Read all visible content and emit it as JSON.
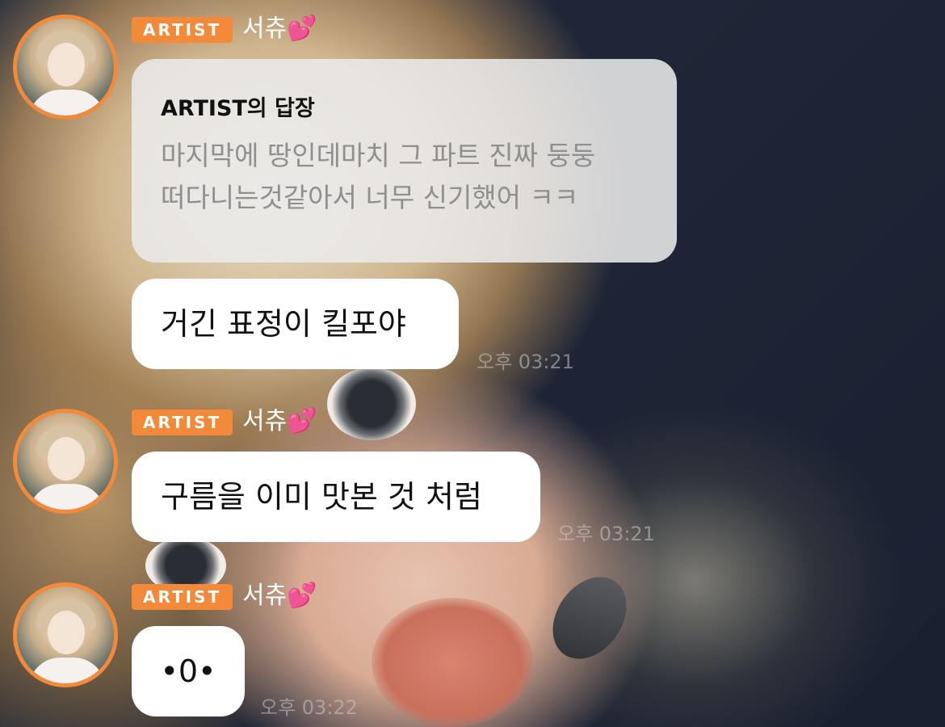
{
  "messages": [
    {
      "badge": "ARTIST",
      "name": "서츄💕",
      "reply": {
        "title": "ARTIST의 답장",
        "line1": "마지막에 땅인데마치 그 파트 진짜 둥둥",
        "line2": "떠다니는것같아서 너무 신기했어 ㅋㅋ"
      },
      "text": "거긴 표정이 킬포야",
      "time": "오후 03:21"
    },
    {
      "badge": "ARTIST",
      "name": "서츄💕",
      "text": "구름을 이미 맛본 것 처럼",
      "time": "오후 03:21"
    },
    {
      "badge": "ARTIST",
      "name": "서츄💕",
      "text": "•0•",
      "time": "오후 03:22"
    }
  ],
  "colors": {
    "accent": "#f28a3a",
    "bubble": "#ffffff",
    "reply_bubble": "#ebebeb",
    "heart": "#ff4fa3"
  }
}
